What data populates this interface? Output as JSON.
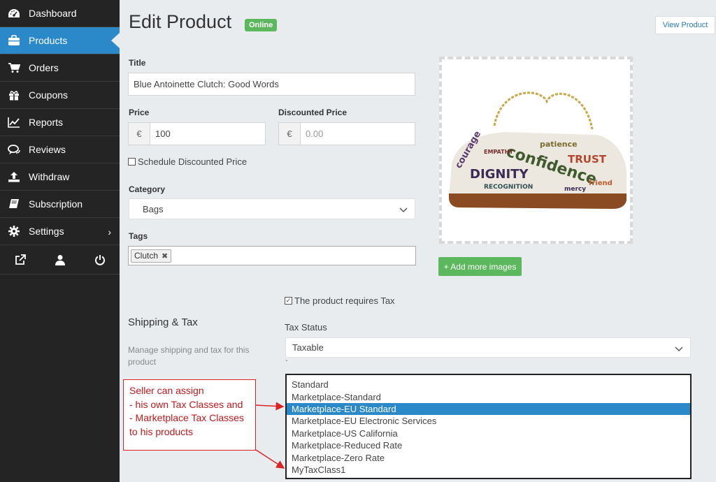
{
  "sidebar": {
    "items": [
      {
        "label": "Dashboard",
        "icon": "tachometer-icon"
      },
      {
        "label": "Products",
        "icon": "briefcase-icon",
        "active": true
      },
      {
        "label": "Orders",
        "icon": "cart-icon"
      },
      {
        "label": "Coupons",
        "icon": "gift-icon"
      },
      {
        "label": "Reports",
        "icon": "line-chart-icon"
      },
      {
        "label": "Reviews",
        "icon": "comments-icon"
      },
      {
        "label": "Withdraw",
        "icon": "upload-icon"
      },
      {
        "label": "Subscription",
        "icon": "book-icon"
      },
      {
        "label": "Settings",
        "icon": "gear-icon"
      }
    ],
    "footer_icons": [
      "external-link-icon",
      "user-icon",
      "power-icon"
    ]
  },
  "header": {
    "title": "Edit Product",
    "status_badge": "Online",
    "view_button": "View Product"
  },
  "form": {
    "title_label": "Title",
    "title_value": "Blue Antoinette Clutch: Good Words",
    "price_label": "Price",
    "price_currency": "€",
    "price_value": "100",
    "discounted_label": "Discounted Price",
    "discounted_currency": "€",
    "discounted_placeholder": "0.00",
    "schedule_label": "Schedule Discounted Price",
    "category_label": "Category",
    "category_value": "Bags",
    "tags_label": "Tags",
    "tags": [
      "Clutch"
    ],
    "add_images_button": "+ Add more images"
  },
  "shipping_tax": {
    "section_title": "Shipping & Tax",
    "section_desc": "Manage shipping and tax for this product",
    "requires_tax_label": "The product requires Tax",
    "requires_tax_checked": true,
    "tax_status_label": "Tax Status",
    "tax_status_value": "Taxable",
    "stray_mark": "`",
    "tax_class_options": [
      "Standard",
      "Marketplace-Standard",
      "Marketplace-EU Standard",
      "Marketplace-EU Electronic Services",
      "Marketplace-US California",
      "Marketplace-Reduced Rate",
      "Marketplace-Zero Rate",
      "MyTaxClass1"
    ],
    "selected_tax_class": "Marketplace-EU Standard"
  },
  "annotation": {
    "lines": [
      "Seller can assign",
      "- his own Tax Classes and",
      "- Marketplace Tax Classes",
      "to his products"
    ]
  },
  "colors": {
    "sidebar_bg": "#242424",
    "active_blue": "#2b89c9",
    "success_green": "#5cb85c",
    "annotation_red": "#d22222"
  }
}
